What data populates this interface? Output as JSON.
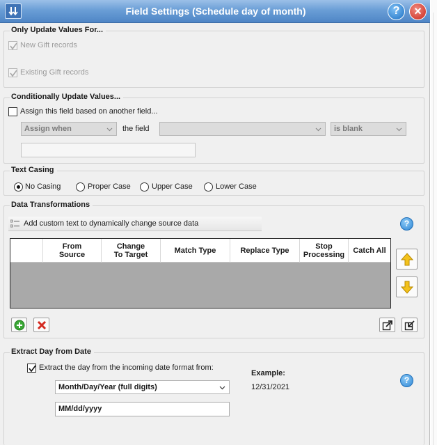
{
  "window": {
    "title": "Field Settings (Schedule day of month)"
  },
  "only_update": {
    "title": "Only Update Values For...",
    "new_gift_label": "New Gift records",
    "new_gift_checked": true,
    "existing_gift_label": "Existing Gift records",
    "existing_gift_checked": true
  },
  "conditional": {
    "title": "Conditionally Update Values...",
    "assign_label": "Assign this field based on another field...",
    "assign_checked": false,
    "assign_when_value": "Assign when",
    "the_field_label": "the field",
    "field_value": "",
    "condition_value": "is blank",
    "value_text": ""
  },
  "text_casing": {
    "title": "Text Casing",
    "options": [
      "No Casing",
      "Proper Case",
      "Upper Case",
      "Lower Case"
    ],
    "selected": "No Casing"
  },
  "data_transformations": {
    "title": "Data Transformations",
    "add_custom_text_label": "Add custom text to dynamically change source data",
    "columns": [
      {
        "line1": "",
        "line2": ""
      },
      {
        "line1": "From",
        "line2": "Source"
      },
      {
        "line1": "Change",
        "line2": "To Target"
      },
      {
        "line1": "Match Type",
        "line2": ""
      },
      {
        "line1": "Replace Type",
        "line2": ""
      },
      {
        "line1": "Stop",
        "line2": "Processing"
      },
      {
        "line1": "Catch All",
        "line2": ""
      }
    ],
    "rows": []
  },
  "extract_day": {
    "title": "Extract Day from Date",
    "checkbox_label": "Extract the day from the incoming date format from:",
    "checked": true,
    "format_value": "Month/Day/Year (full digits)",
    "pattern_value": "MM/dd/yyyy",
    "example_label": "Example:",
    "example_value": "12/31/2021"
  },
  "icons": {
    "help": "?",
    "close": "×"
  },
  "colors": {
    "title_gradient_top": "#9cc0e8",
    "title_gradient_bottom": "#4f86c6",
    "help_blue": "#2f86d4",
    "close_red": "#c8271b",
    "add_green": "#3aa835",
    "delete_red": "#d42a20",
    "arrow_yellow": "#f3c21c"
  }
}
